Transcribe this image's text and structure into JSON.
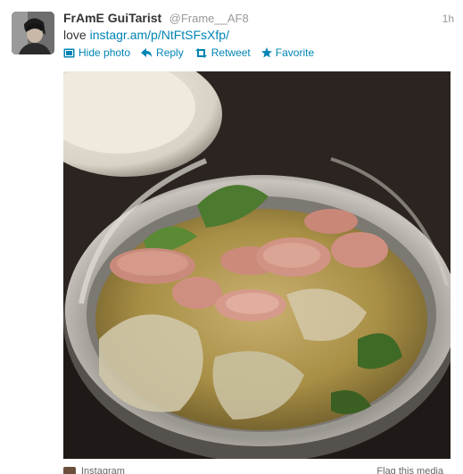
{
  "tweet": {
    "fullname": "FrAmE GuiTarist",
    "username": "@Frame__AF8",
    "time": "1h",
    "text_prefix": "love ",
    "link": "instagr.am/p/NtFtSFsXfp/",
    "actions": {
      "hide_photo": "Hide photo",
      "reply": "Reply",
      "retweet": "Retweet",
      "favorite": "Favorite"
    }
  },
  "footer": {
    "source": "Instagram",
    "flag": "Flag this media"
  },
  "colors": {
    "link": "#0084b4",
    "text": "#333333",
    "muted": "#999999"
  },
  "icons": [
    "avatar-photo",
    "photo-icon",
    "reply-arrow-icon",
    "retweet-icon",
    "star-icon",
    "instagram-icon"
  ]
}
